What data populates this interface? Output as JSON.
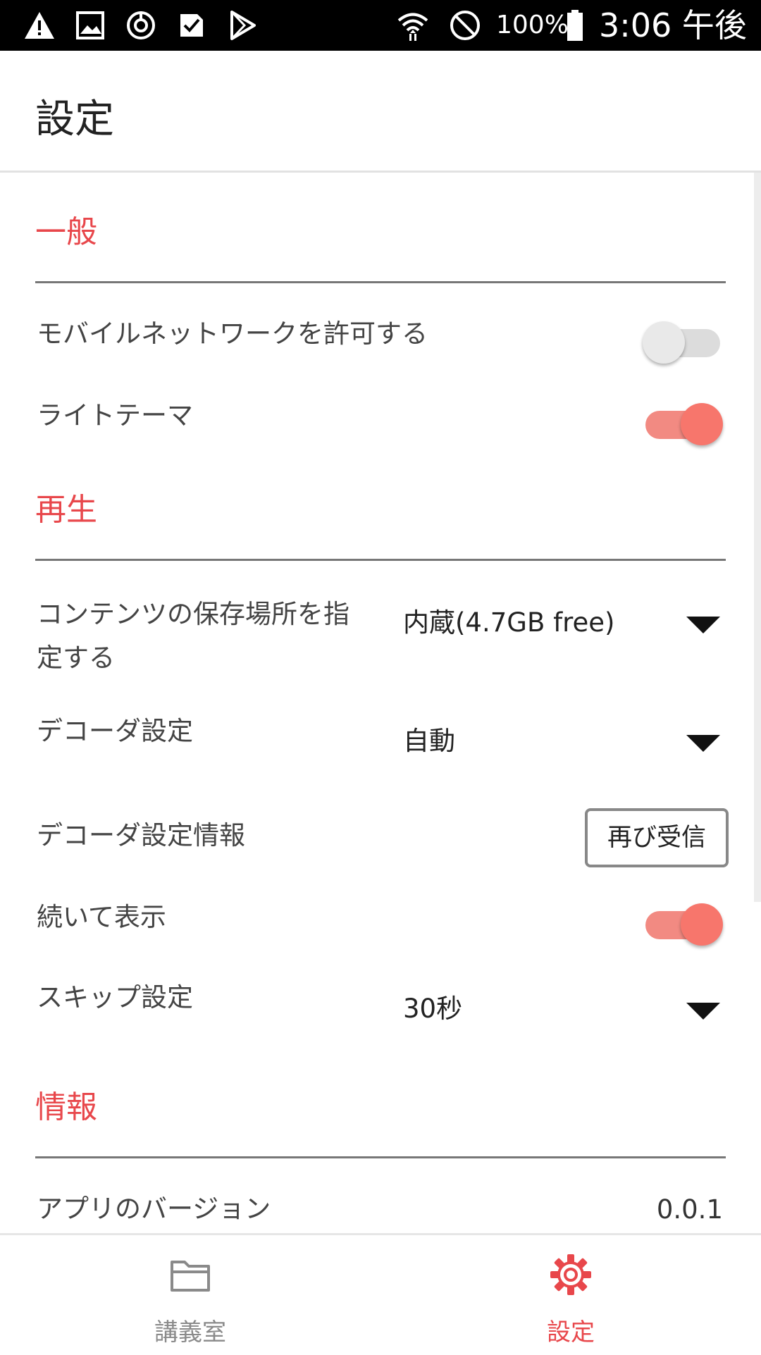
{
  "status_bar": {
    "icons": [
      "warning-icon",
      "image-icon",
      "sync-icon",
      "check-icon",
      "play-store-icon",
      "wifi-icon",
      "do-not-disturb-icon",
      "battery-icon"
    ],
    "battery": "100%",
    "time": "3:06 午後"
  },
  "header": {
    "title": "設定"
  },
  "sections": {
    "general": {
      "title": "一般",
      "mobile_network": {
        "label": "モバイルネットワークを許可する",
        "enabled": false
      },
      "light_theme": {
        "label": "ライトテーマ",
        "enabled": true
      }
    },
    "playback": {
      "title": "再生",
      "storage": {
        "label": "コンテンツの保存場所を指定する",
        "value": "内蔵(4.7GB free)"
      },
      "decoder": {
        "label": "デコーダ設定",
        "value": "自動"
      },
      "decoder_info": {
        "label": "デコーダ設定情報",
        "button": "再び受信"
      },
      "autoplay": {
        "label": "続いて表示",
        "enabled": true
      },
      "skip": {
        "label": "スキップ設定",
        "value": "30秒"
      }
    },
    "info": {
      "title": "情報",
      "version": {
        "label": "アプリのバージョン",
        "value": "0.0.1"
      }
    }
  },
  "bottom_nav": [
    {
      "label": "講義室",
      "icon": "folder-icon",
      "active": false
    },
    {
      "label": "設定",
      "icon": "gear-icon",
      "active": true
    }
  ],
  "colors": {
    "accent": "#e8474b",
    "toggle_on": "#f7766c",
    "toggle_off": "#dcdcdc"
  }
}
